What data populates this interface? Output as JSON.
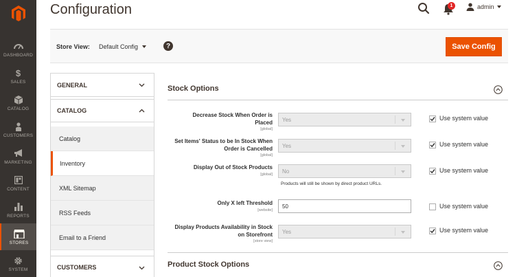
{
  "nav": {
    "items": [
      {
        "label": "DASHBOARD",
        "icon": "dashboard-icon"
      },
      {
        "label": "SALES",
        "icon": "dollar-icon"
      },
      {
        "label": "CATALOG",
        "icon": "cube-icon"
      },
      {
        "label": "CUSTOMERS",
        "icon": "person-icon"
      },
      {
        "label": "MARKETING",
        "icon": "megaphone-icon"
      },
      {
        "label": "CONTENT",
        "icon": "content-icon"
      },
      {
        "label": "REPORTS",
        "icon": "bar-chart-icon"
      },
      {
        "label": "STORES",
        "icon": "store-icon"
      },
      {
        "label": "SYSTEM",
        "icon": "gear-icon"
      }
    ],
    "accent": "#eb5202"
  },
  "header": {
    "title": "Configuration",
    "notification_count": "1",
    "user": "admin"
  },
  "store_bar": {
    "label": "Store View:",
    "value": "Default Config",
    "help": "?",
    "save_label": "Save Config"
  },
  "tabs": {
    "general": "GENERAL",
    "catalog": "CATALOG",
    "items": [
      "Catalog",
      "Inventory",
      "XML Sitemap",
      "RSS Feeds",
      "Email to a Friend"
    ],
    "customers": "CUSTOMERS"
  },
  "stock_options": {
    "title": "Stock Options",
    "fields": [
      {
        "label": "Decrease Stock When Order is Placed",
        "scope": "[global]",
        "value": "Yes",
        "use_system": "Use system value",
        "checked": true
      },
      {
        "label": "Set Items' Status to be In Stock When Order is Cancelled",
        "scope": "[global]",
        "value": "Yes",
        "use_system": "Use system value",
        "checked": true
      },
      {
        "label": "Display Out of Stock Products",
        "scope": "[global]",
        "value": "No",
        "note": "Products will still be shown by direct product URLs.",
        "use_system": "Use system value",
        "checked": true
      },
      {
        "label": "Only X left Threshold",
        "scope": "[website]",
        "value": "50",
        "use_system": "Use system value",
        "checked": false
      },
      {
        "label": "Display Products Availability in Stock on Storefront",
        "scope": "[store view]",
        "value": "Yes",
        "use_system": "Use system value",
        "checked": true
      }
    ]
  },
  "product_stock_options": {
    "title": "Product Stock Options"
  }
}
